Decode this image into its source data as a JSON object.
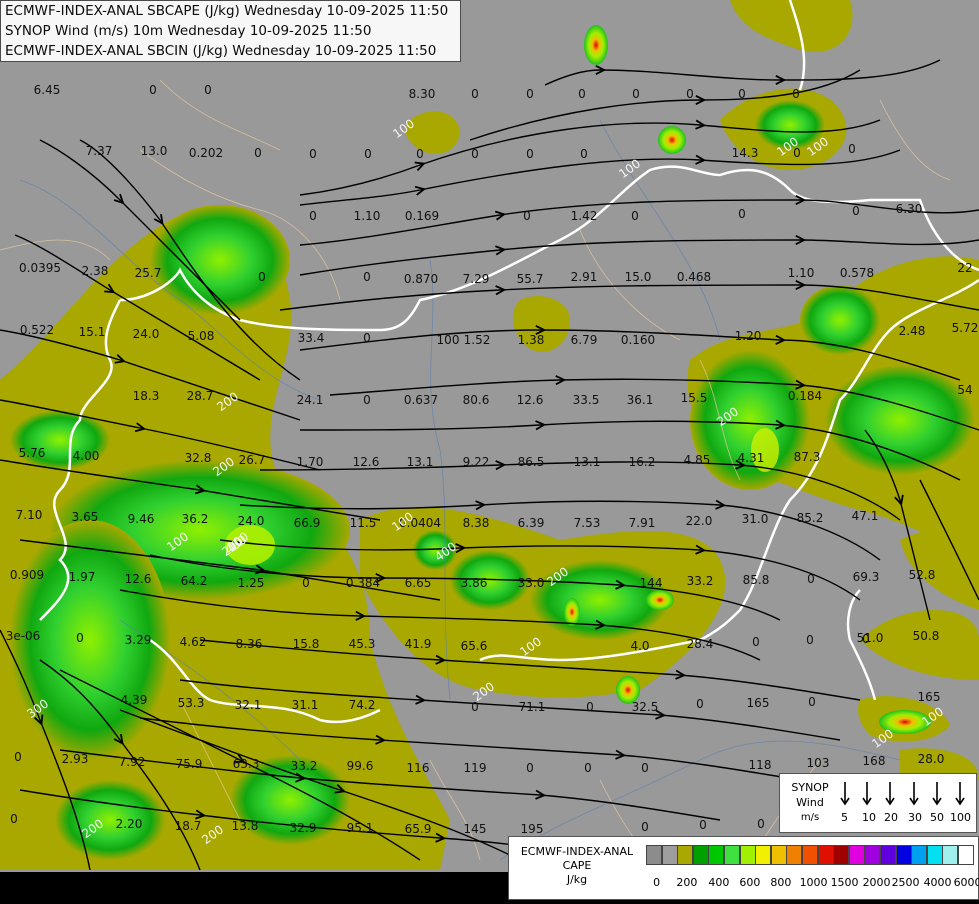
{
  "titles": [
    "ECMWF-INDEX-ANAL SBCAPE (J/kg) Wednesday 10-09-2025 11:50",
    "SYNOP Wind (m/s) 10m Wednesday 10-09-2025 11:50",
    "ECMWF-INDEX-ANAL SBCIN (J/kg) Wednesday 10-09-2025 11:50"
  ],
  "colors": {
    "background": "#999999",
    "cape_olive": "#a8a800",
    "cape_green": "#2ecc2e",
    "cape_lime": "#80f000",
    "border": "#ffffff",
    "streamline": "#000000"
  },
  "station_values": [
    "6.45",
    "0",
    "0",
    "8.30",
    "0",
    "0",
    "0",
    "0",
    "0",
    "0",
    "0",
    "7.37",
    "13.0",
    "0.202",
    "0",
    "0",
    "0",
    "0",
    "0",
    "0",
    "0",
    "14.3",
    "0",
    "0",
    "0",
    "1.10",
    "0.169",
    "0",
    "1.42",
    "0",
    "0",
    "0",
    "6.30",
    "0.0395",
    "2.38",
    "25.7",
    "0",
    "0",
    "0.870",
    "7.29",
    "55.7",
    "2.91",
    "15.0",
    "0.468",
    "1.10",
    "0.578",
    "22",
    "0.522",
    "15.1",
    "24.0",
    "5.08",
    "33.4",
    "0",
    "100",
    "1.52",
    "1.38",
    "6.79",
    "0.160",
    "1.20",
    "2.48",
    "5.72",
    "18.3",
    "28.7",
    "24.1",
    "0",
    "0.637",
    "80.6",
    "12.6",
    "33.5",
    "36.1",
    "15.5",
    "0.184",
    "54",
    "5.76",
    "4.00",
    "32.8",
    "26.7",
    "1.70",
    "12.6",
    "13.1",
    "9.22",
    "86.5",
    "13.1",
    "16.2",
    "4.85",
    "4.31",
    "87.3",
    "7.10",
    "3.65",
    "9.46",
    "36.2",
    "24.0",
    "66.9",
    "11.5",
    "0.0404",
    "8.38",
    "6.39",
    "7.53",
    "7.91",
    "22.0",
    "31.0",
    "85.2",
    "47.1",
    "0.909",
    "1.97",
    "12.6",
    "64.2",
    "1.25",
    "0",
    "0.384",
    "6.65",
    "3.86",
    "33.0",
    "144",
    "33.2",
    "85.8",
    "0",
    "69.3",
    "52.8",
    "3e-06",
    "0",
    "3.29",
    "4.62",
    "8.36",
    "15.8",
    "45.3",
    "41.9",
    "65.6",
    "4.0",
    "28.4",
    "0",
    "0",
    "0",
    "51.0",
    "50.8",
    "4.39",
    "53.3",
    "32.1",
    "31.1",
    "74.2",
    "0",
    "71.1",
    "0",
    "32.5",
    "0",
    "165",
    "0",
    "165",
    "0",
    "2.93",
    "7.92",
    "75.9",
    "63.3",
    "33.2",
    "99.6",
    "116",
    "119",
    "0",
    "0",
    "0",
    "118",
    "103",
    "168",
    "28.0",
    "0",
    "2.20",
    "18.7",
    "13.8",
    "32.9",
    "95.1",
    "65.9",
    "145",
    "195",
    "0",
    "0",
    "0",
    "0"
  ],
  "contour_labels": [
    "100",
    "100",
    "100",
    "100",
    "100",
    "200",
    "200",
    "100",
    "100",
    "100",
    "200",
    "100",
    "400",
    "400",
    "200",
    "200",
    "100",
    "100",
    "300",
    "200",
    "200",
    "200"
  ],
  "wind_legend": {
    "title_line1": "SYNOP",
    "title_line2": "Wind",
    "unit": "m/s",
    "speeds": [
      "5",
      "10",
      "20",
      "30",
      "50",
      "100"
    ]
  },
  "cape_legend": {
    "title_line1": "ECMWF-INDEX-ANAL",
    "title_line2": "CAPE",
    "unit": "J/kg",
    "labels": [
      "0",
      "200",
      "400",
      "600",
      "800",
      "1000",
      "1500",
      "2000",
      "2500",
      "4000",
      "6000"
    ],
    "colors": [
      "#8c8c8c",
      "#9e9e9e",
      "#a8a800",
      "#00a000",
      "#00c800",
      "#40e040",
      "#a0f000",
      "#f0f000",
      "#f0c000",
      "#f08000",
      "#f05000",
      "#e01000",
      "#a00000",
      "#e000e0",
      "#a000e0",
      "#6000e0",
      "#0000e0",
      "#00a0f0",
      "#00e0f0",
      "#a0f0f0",
      "#ffffff"
    ]
  }
}
